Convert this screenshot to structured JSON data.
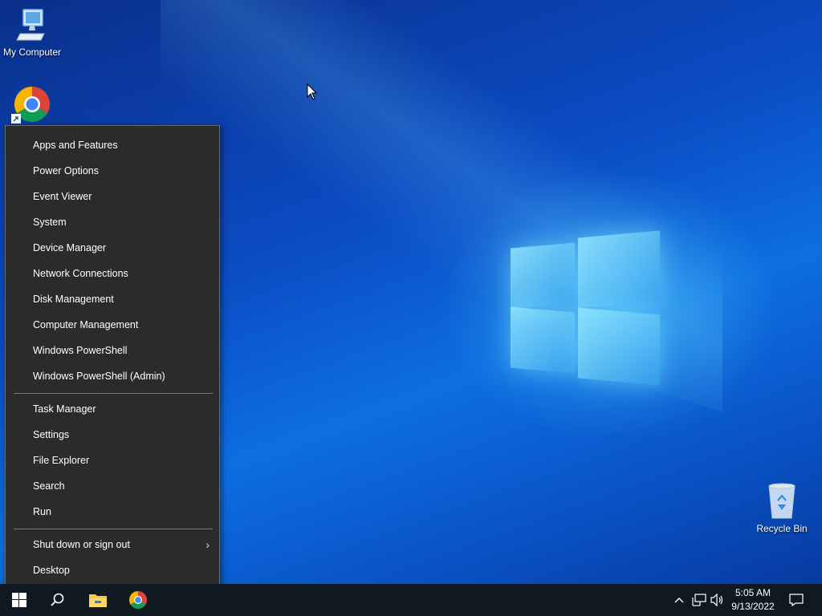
{
  "desktop": {
    "icons": [
      {
        "label": "My Computer",
        "icon": "computer-icon"
      },
      {
        "label": "",
        "icon": "chrome-shortcut-icon"
      },
      {
        "label": "Recycle Bin",
        "icon": "recycle-bin-icon"
      }
    ]
  },
  "context_menu": {
    "group1": [
      "Apps and Features",
      "Power Options",
      "Event Viewer",
      "System",
      "Device Manager",
      "Network Connections",
      "Disk Management",
      "Computer Management",
      "Windows PowerShell",
      "Windows PowerShell (Admin)"
    ],
    "group2": [
      "Task Manager",
      "Settings",
      "File Explorer",
      "Search",
      "Run"
    ],
    "group3": [
      "Shut down or sign out",
      "Desktop"
    ]
  },
  "taskbar": {
    "start_icon": "windows-start-icon",
    "search_icon": "search-icon",
    "pinned": [
      "file-explorer-icon",
      "chrome-icon"
    ],
    "tray_icons": [
      "chevron-up-icon",
      "network-icon",
      "volume-icon"
    ],
    "clock_time": "5:05 AM",
    "clock_date": "9/13/2022",
    "notification_icon": "action-center-icon"
  },
  "colors": {
    "menu_bg": "#2b2b2b",
    "taskbar_bg": "#101922",
    "accent": "#0d6fe0"
  }
}
